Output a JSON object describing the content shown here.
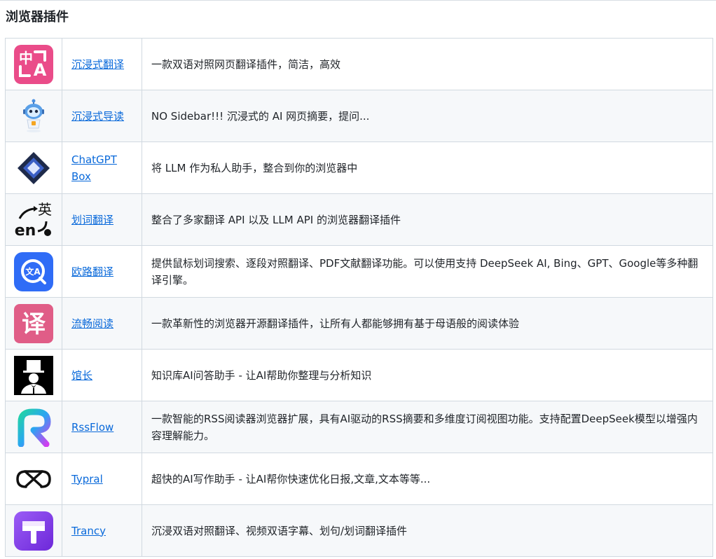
{
  "section": {
    "title": "浏览器插件"
  },
  "plugins": [
    {
      "name": "沉浸式翻译",
      "description": "一款双语对照网页翻译插件，简洁，高效"
    },
    {
      "name": "沉浸式导读",
      "description": "NO Sidebar!!! 沉浸式的 AI 网页摘要，提问..."
    },
    {
      "name": "ChatGPT Box",
      "description": "将 LLM 作为私人助手，整合到你的浏览器中"
    },
    {
      "name": "划词翻译",
      "description": "整合了多家翻译 API 以及 LLM API 的浏览器翻译插件"
    },
    {
      "name": "欧路翻译",
      "description": "提供鼠标划词搜索、逐段对照翻译、PDF文献翻译功能。可以使用支持 DeepSeek AI, Bing、GPT、Google等多种翻译引擎。"
    },
    {
      "name": "流畅阅读",
      "description": "一款革新性的浏览器开源翻译插件，让所有人都能够拥有基于母语般的阅读体验"
    },
    {
      "name": "馆长",
      "description": "知识库AI问答助手 - 让AI帮助你整理与分析知识"
    },
    {
      "name": "RssFlow",
      "description": "一款智能的RSS阅读器浏览器扩展，具有AI驱动的RSS摘要和多维度订阅视图功能。支持配置DeepSeek模型以增强内容理解能力。"
    },
    {
      "name": "Typral",
      "description": "超快的AI写作助手 - 让AI帮你快速优化日报,文章,文本等等..."
    },
    {
      "name": "Trancy",
      "description": "沉浸双语对照翻译、视频双语字幕、划句/划词翻译插件"
    }
  ],
  "icons": {
    "immersive_translate": {
      "glyph_top": "中",
      "glyph_bottom": "A",
      "bg": "#ea4c89"
    },
    "huaci_en": "en",
    "huaci_zh": "英",
    "eudic_glyph": "文A",
    "liuchang_glyph": "译",
    "colors": {
      "link": "#0969da",
      "row_alt": "#f6f8fa",
      "border": "#d1d9e0"
    }
  }
}
